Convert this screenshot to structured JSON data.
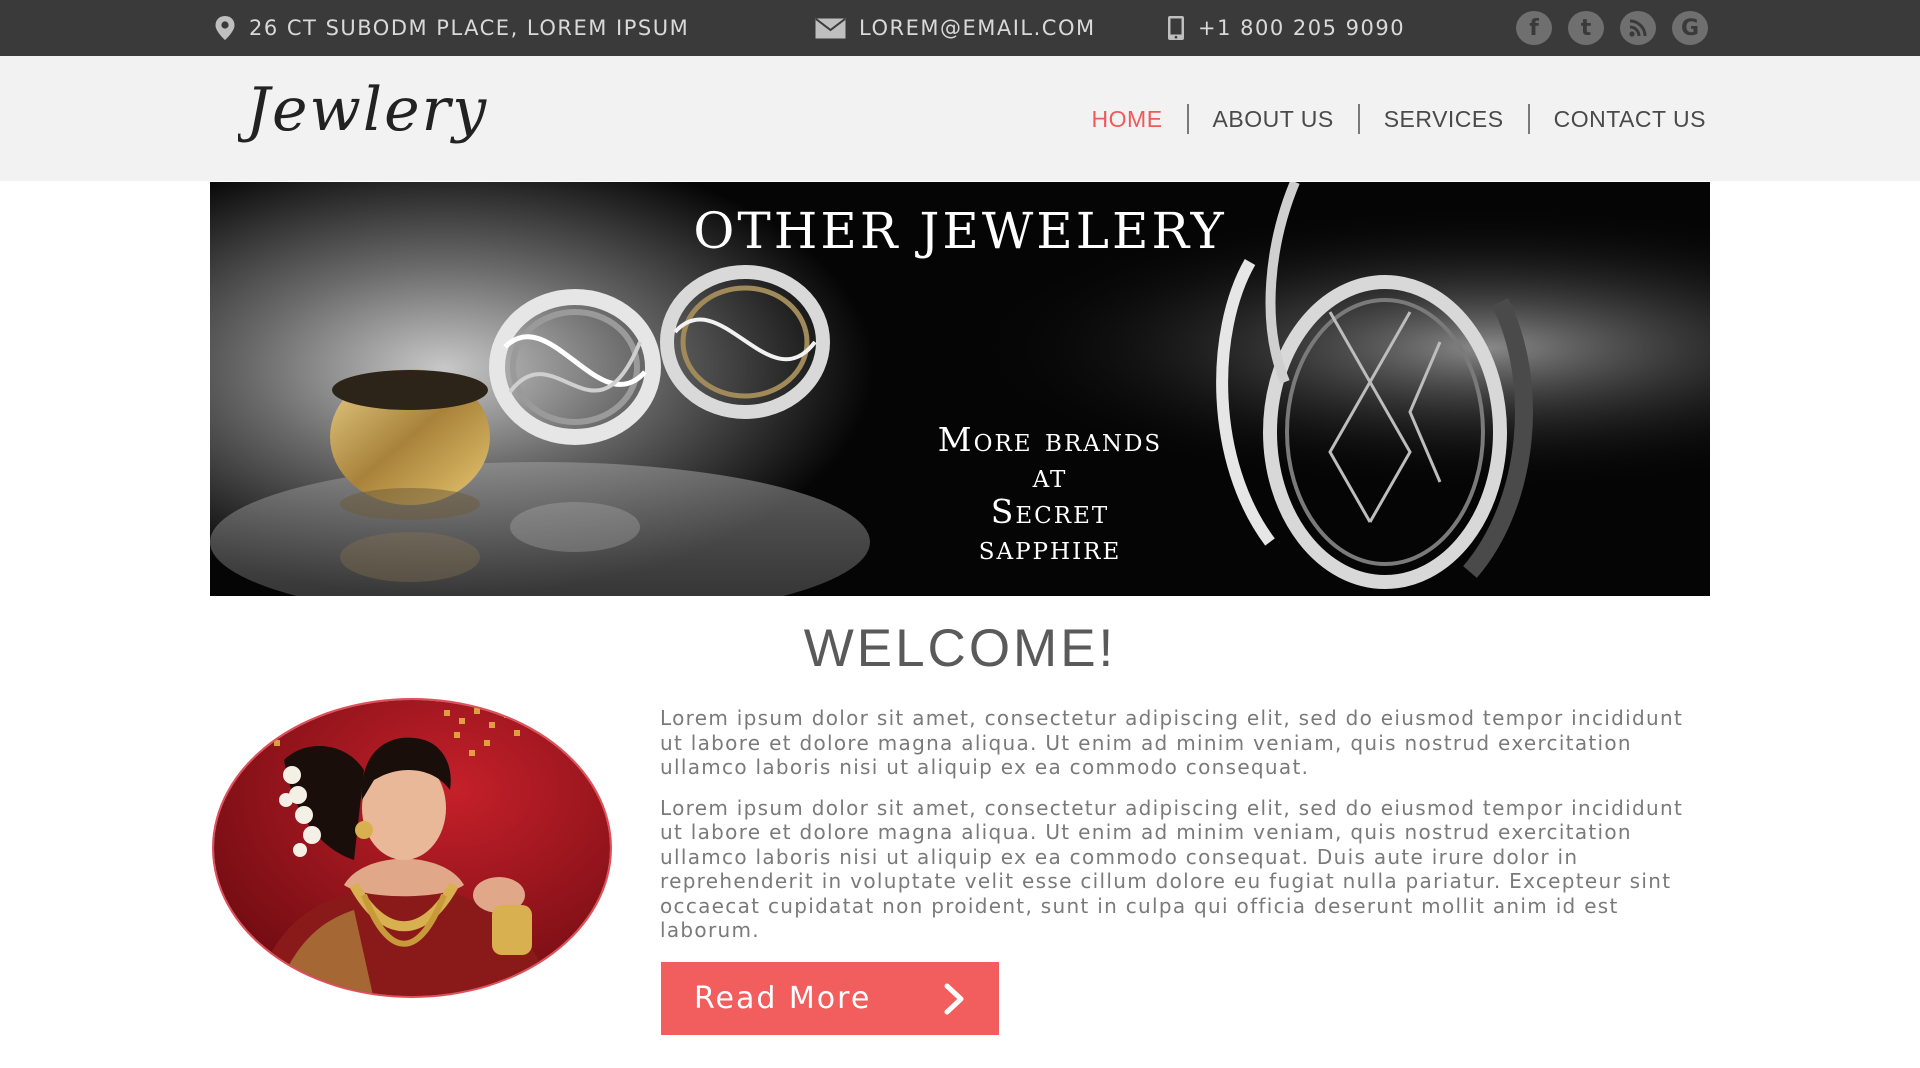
{
  "topbar": {
    "address": "26 CT SUBODM PLACE, LOREM IPSUM",
    "email": "LOREM@EMAIL.COM",
    "phone": "+1 800 205 9090",
    "address_icon": "map-pin-icon",
    "email_icon": "envelope-icon",
    "phone_icon": "mobile-phone-icon",
    "social": [
      {
        "name": "facebook-icon",
        "glyph": "f"
      },
      {
        "name": "tumblr-icon",
        "glyph": "t"
      },
      {
        "name": "rss-icon",
        "glyph": ")"
      },
      {
        "name": "google-icon",
        "glyph": "G"
      }
    ]
  },
  "header": {
    "logo_text": "Jewlery",
    "nav": [
      {
        "label": "HOME",
        "active": true
      },
      {
        "label": "ABOUT US",
        "active": false
      },
      {
        "label": "SERVICES",
        "active": false
      },
      {
        "label": "CONTACT US",
        "active": false
      }
    ]
  },
  "banner": {
    "title": "OTHER JEWELERY",
    "tagline_lines": [
      "More brands",
      "at",
      "Secret",
      "sapphire"
    ]
  },
  "welcome": {
    "heading": "WELCOME!",
    "paragraphs": [
      "Lorem ipsum dolor sit amet, consectetur adipiscing elit, sed do eiusmod tempor incididunt ut labore et dolore magna aliqua. Ut enim ad minim veniam, quis nostrud exercitation ullamco laboris nisi ut aliquip ex ea commodo consequat.",
      "Lorem ipsum dolor sit amet, consectetur adipiscing elit, sed do eiusmod tempor incididunt ut labore et dolore magna aliqua. Ut enim ad minim veniam, quis nostrud exercitation ullamco laboris nisi ut aliquip ex ea commodo consequat. Duis aute irure dolor in reprehenderit in voluptate velit esse cillum dolore eu fugiat nulla pariatur. Excepteur sint occaecat cupidatat non proident, sunt in culpa qui officia deserunt mollit anim id est laborum."
    ],
    "button_label": "Read More",
    "button_icon": "chevron-right-icon"
  },
  "colors": {
    "accent": "#f25d5d",
    "topbar_bg": "#3a3a3a",
    "header_bg": "#f2f2f2",
    "body_text": "#7a7a7a"
  }
}
